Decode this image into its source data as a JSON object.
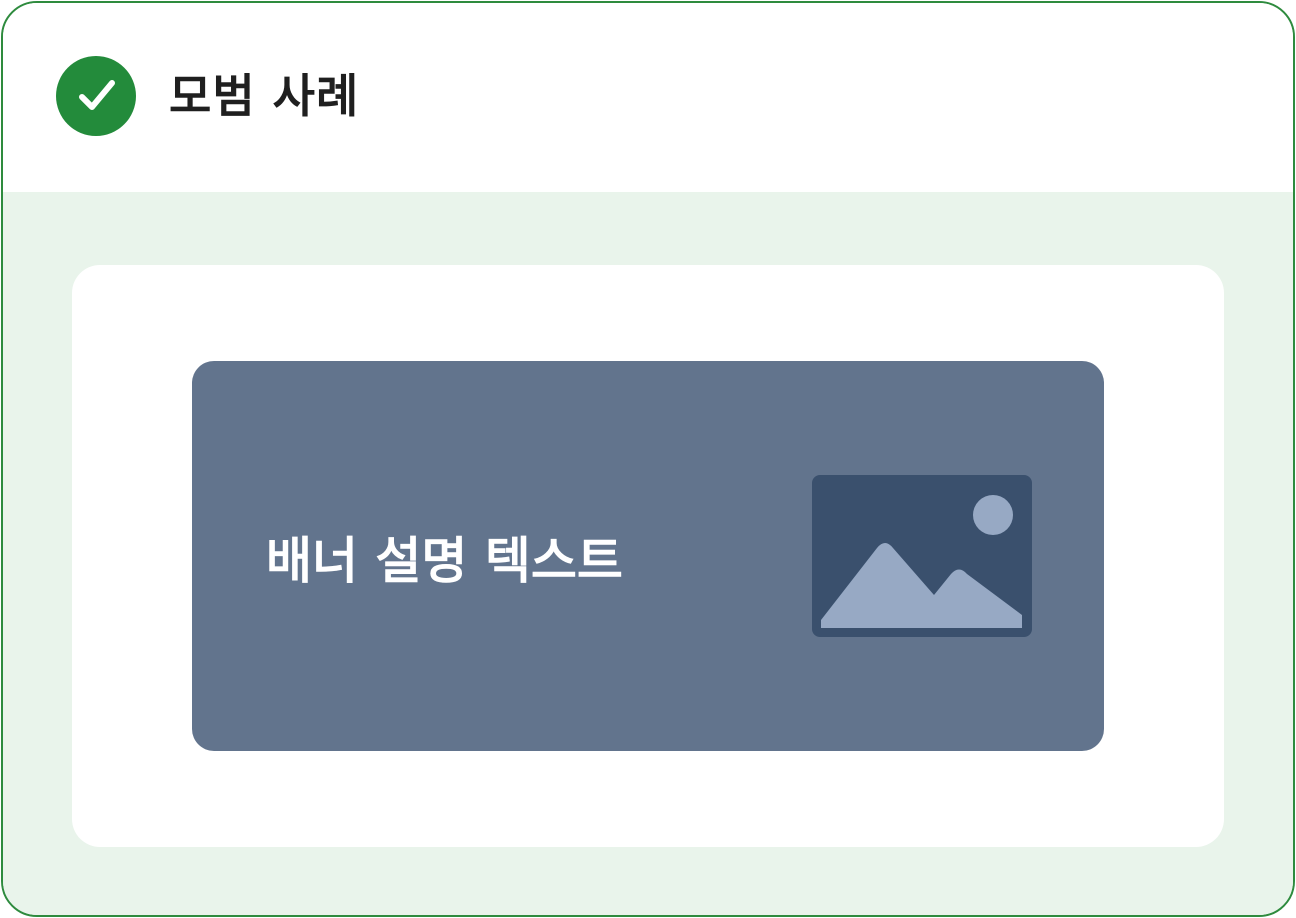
{
  "header": {
    "title": "모범 사례",
    "status_icon": "check-circle-icon"
  },
  "banner": {
    "text": "배너 설명 텍스트",
    "image_icon": "image-placeholder-icon"
  },
  "colors": {
    "border": "#2e8b3e",
    "check_badge": "#238b3b",
    "body_background": "#e9f4eb",
    "banner_background": "#62748d",
    "image_frame": "#3a506d",
    "image_shapes": "#97a9c4"
  }
}
